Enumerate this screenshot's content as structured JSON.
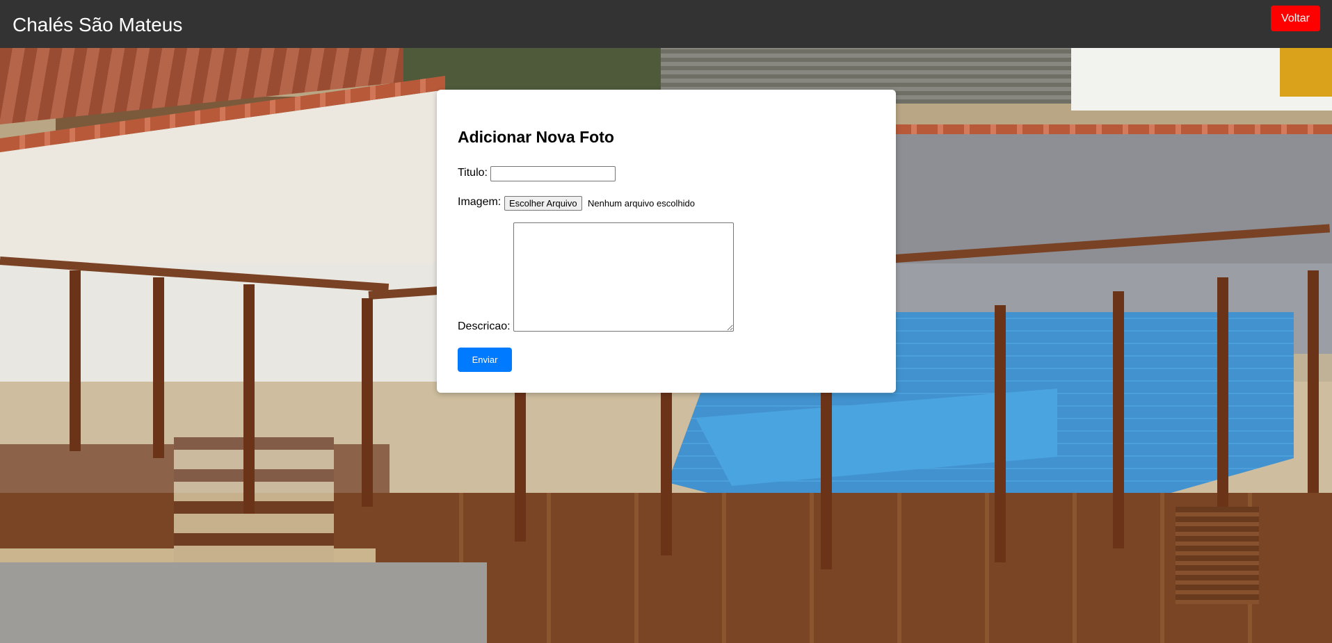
{
  "header": {
    "title": "Chalés São Mateus",
    "back_label": "Voltar"
  },
  "form": {
    "heading": "Adicionar Nova Foto",
    "title_label": "Titulo:",
    "title_value": "",
    "image_label": "Imagem:",
    "file_button_label": "Escolher Arquivo",
    "file_status": "Nenhum arquivo escolhido",
    "description_label": "Descricao:",
    "description_value": "",
    "submit_label": "Enviar"
  },
  "colors": {
    "header_bg": "#333333",
    "back_button": "#ff0000",
    "submit_button": "#007bff"
  }
}
